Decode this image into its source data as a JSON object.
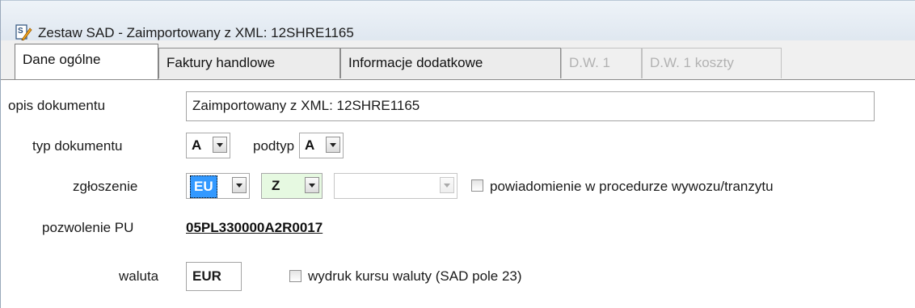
{
  "window": {
    "title": "Zestaw SAD - Zaimportowany z XML: 12SHRE1165",
    "icon": "document-pencil-icon"
  },
  "tabs": [
    {
      "label": "Dane ogólne",
      "state": "active"
    },
    {
      "label": "Faktury handlowe",
      "state": "enabled"
    },
    {
      "label": "Informacje dodatkowe",
      "state": "enabled"
    },
    {
      "label": "D.W. 1",
      "state": "disabled"
    },
    {
      "label": "D.W. 1  koszty",
      "state": "disabled"
    }
  ],
  "form": {
    "opis_label": "opis dokumentu",
    "opis_value": "Zaimportowany z XML: 12SHRE1165",
    "typ_label": "typ dokumentu",
    "typ_value": "A",
    "podtyp_label": "podtyp",
    "podtyp_value": "A",
    "zgloszenie_label": "zgłoszenie",
    "zgloszenie_value1": "EU",
    "zgloszenie_value2": "Z",
    "zgloszenie_value3": "",
    "powiadomienie_label": "powiadomienie w procedurze wywozu/tranzytu",
    "powiadomienie_checked": false,
    "pozwolenie_label": "pozwolenie PU",
    "pozwolenie_value": "05PL330000A2R0017",
    "waluta_label": "waluta",
    "waluta_value": "EUR",
    "wydruk_label": "wydruk kursu waluty (SAD pole 23)",
    "wydruk_checked": false
  },
  "colors": {
    "selected_highlight": "#3399ff",
    "green_field": "#e6f9e1",
    "disabled_text": "#b2b2b2"
  }
}
